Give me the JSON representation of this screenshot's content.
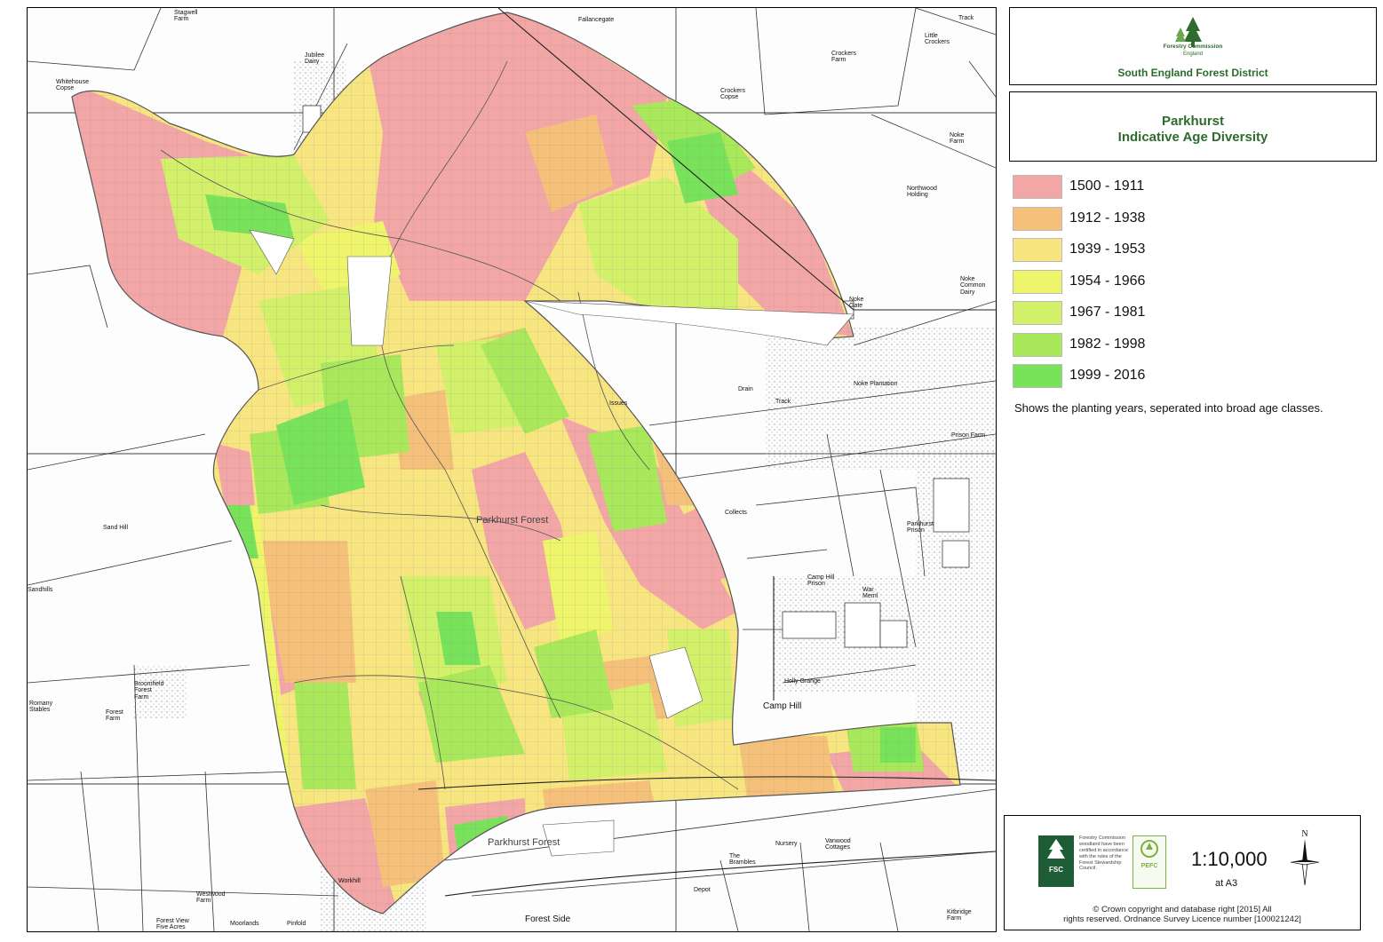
{
  "header": {
    "organisation": "Forestry Commission",
    "organisation_sub": "England",
    "district": "South England Forest District"
  },
  "title": {
    "line1": "Parkhurst",
    "line2": "Indicative Age Diversity"
  },
  "legend": {
    "items": [
      {
        "label": "1500 - 1911",
        "color": "#f3a6a6"
      },
      {
        "label": "1912 - 1938",
        "color": "#f5c07a"
      },
      {
        "label": "1939 - 1953",
        "color": "#f7e580"
      },
      {
        "label": "1954 - 1966",
        "color": "#eef56a"
      },
      {
        "label": "1967 - 1981",
        "color": "#d3f06a"
      },
      {
        "label": "1982 - 1998",
        "color": "#a8e85a"
      },
      {
        "label": "1999 - 2016",
        "color": "#78e35a"
      }
    ],
    "note": "Shows the planting years, seperated into broad age classes."
  },
  "map": {
    "labels": [
      {
        "id": "stagwell",
        "text": "Stagwell\nFarm"
      },
      {
        "id": "fallancegate",
        "text": "Fallancegate"
      },
      {
        "id": "jubilee",
        "text": "Jubilee\nDairy"
      },
      {
        "id": "whitehouse",
        "text": "Whitehouse\nCopse"
      },
      {
        "id": "crockers",
        "text": "Crockers\nFarm"
      },
      {
        "id": "little-crockers",
        "text": "Little\nCrockers"
      },
      {
        "id": "crockers-copse",
        "text": "Crockers\nCopse"
      },
      {
        "id": "noke-farm",
        "text": "Noke\nFarm"
      },
      {
        "id": "northwood",
        "text": "Northwood\nHolding"
      },
      {
        "id": "noke-gate",
        "text": "Noke\nGate"
      },
      {
        "id": "noke-common",
        "text": "Noke\nCommon\nDairy"
      },
      {
        "id": "noke-plantation",
        "text": "Noke Plantation"
      },
      {
        "id": "prison-farm",
        "text": "Prison Farm"
      },
      {
        "id": "parkhurst-prison",
        "text": "Parkhurst\nPrison"
      },
      {
        "id": "camp-hill-prison",
        "text": "Camp Hill\nPrison"
      },
      {
        "id": "camp-hill",
        "text": "Camp Hill"
      },
      {
        "id": "sand-hill",
        "text": "Sand Hill"
      },
      {
        "id": "sandhills",
        "text": "Sandhills"
      },
      {
        "id": "broomfield",
        "text": "Broomfield\nForest\nFarm"
      },
      {
        "id": "romany",
        "text": "Romany\nStables"
      },
      {
        "id": "forest-farm",
        "text": "Forest\nFarm"
      },
      {
        "id": "westwood",
        "text": "Westwood\nFarm"
      },
      {
        "id": "forest-view",
        "text": "Forest View\nFive Acres"
      },
      {
        "id": "moorlands",
        "text": "Moorlands"
      },
      {
        "id": "pinfold",
        "text": "Pinfold"
      },
      {
        "id": "workhill",
        "text": "Workhill"
      },
      {
        "id": "forest-side",
        "text": "Forest Side"
      },
      {
        "id": "the-brambles",
        "text": "The\nBrambles"
      },
      {
        "id": "nursery",
        "text": "Nursery"
      },
      {
        "id": "vanwood",
        "text": "Vanwood\nCottages"
      },
      {
        "id": "kitbridge",
        "text": "Kitbridge\nFarm"
      },
      {
        "id": "depot",
        "text": "Depot"
      },
      {
        "id": "collects",
        "text": "Collects"
      },
      {
        "id": "issues",
        "text": "Issues"
      },
      {
        "id": "parkhurst-forest-n",
        "text": "Parkhurst Forest"
      },
      {
        "id": "parkhurst-forest-s",
        "text": "Parkhurst Forest"
      },
      {
        "id": "holly-grange",
        "text": "Holly Grange"
      },
      {
        "id": "war-meml",
        "text": "War\nMeml"
      },
      {
        "id": "track-1",
        "text": "Track"
      },
      {
        "id": "track-2",
        "text": "Track"
      },
      {
        "id": "drain-1",
        "text": "Drain"
      }
    ]
  },
  "footer": {
    "fsc_badge": "FSC",
    "fsc_text": "Forestry Commission woodland have been certified in accordance with the rules of the Forest Stewardship Council.",
    "pefc_badge": "PEFC",
    "scale": "1:10,000",
    "scale_sub": "at A3",
    "north": "N",
    "copyright_line1": "© Crown copyright and database right [2015] All",
    "copyright_line2": "rights reserved. Ordnance Survey Licence number [100021242]"
  }
}
